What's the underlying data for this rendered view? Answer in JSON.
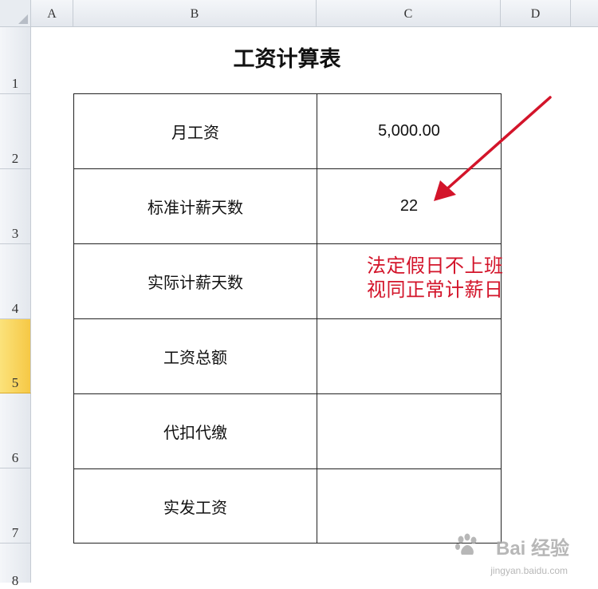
{
  "columns": [
    "A",
    "B",
    "C",
    "D"
  ],
  "rows": [
    "1",
    "2",
    "3",
    "4",
    "5",
    "6",
    "7",
    "8"
  ],
  "sheet": {
    "title": "工资计算表",
    "table": [
      {
        "label": "月工资",
        "value": "5,000.00"
      },
      {
        "label": "标准计薪天数",
        "value": "22"
      },
      {
        "label": "实际计薪天数",
        "value": ""
      },
      {
        "label": "工资总额",
        "value": ""
      },
      {
        "label": "代扣代缴",
        "value": ""
      },
      {
        "label": "实发工资",
        "value": ""
      }
    ]
  },
  "annotation": {
    "line1": "法定假日不上班",
    "line2": "视同正常计薪日",
    "color": "#d3142a"
  },
  "watermark": {
    "brand": "Bai  经验",
    "url": "jingyan.baidu.com"
  },
  "selected_row": "5"
}
